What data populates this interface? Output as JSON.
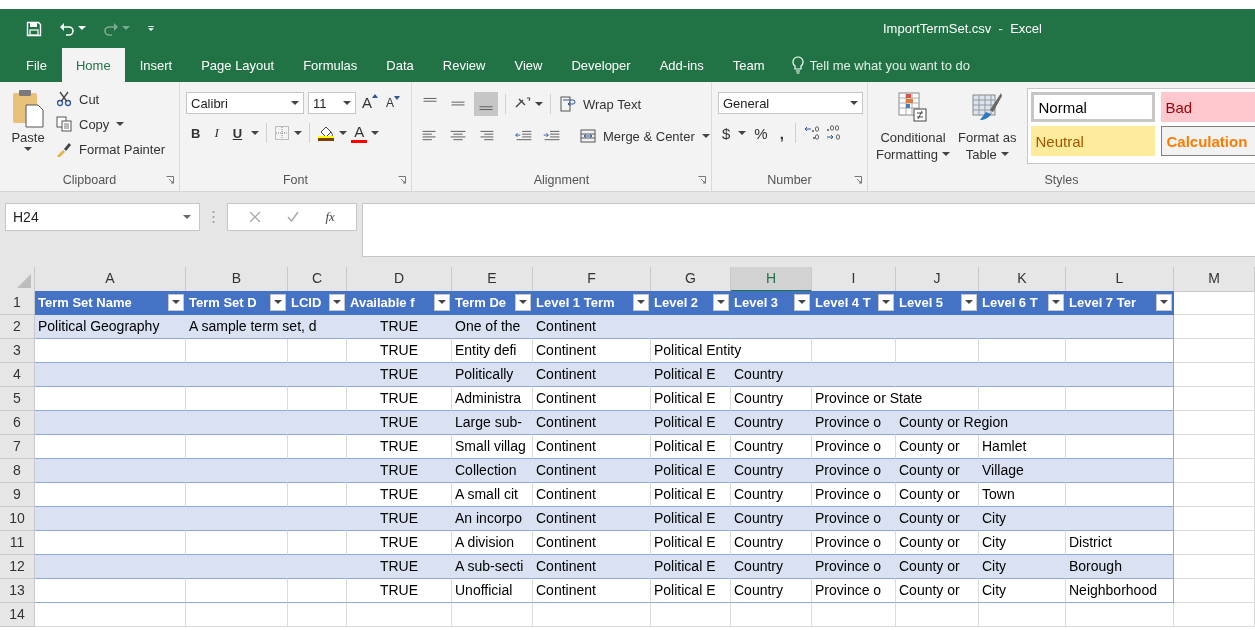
{
  "window": {
    "title": "ImportTermSet.csv  -  Excel"
  },
  "quick_access": {
    "redo_disabled": true
  },
  "tabs": [
    {
      "label": "File",
      "selected": false
    },
    {
      "label": "Home",
      "selected": true
    },
    {
      "label": "Insert",
      "selected": false
    },
    {
      "label": "Page Layout",
      "selected": false
    },
    {
      "label": "Formulas",
      "selected": false
    },
    {
      "label": "Data",
      "selected": false
    },
    {
      "label": "Review",
      "selected": false
    },
    {
      "label": "View",
      "selected": false
    },
    {
      "label": "Developer",
      "selected": false
    },
    {
      "label": "Add-ins",
      "selected": false
    },
    {
      "label": "Team",
      "selected": false
    }
  ],
  "tell_me": {
    "placeholder": "Tell me what you want to do"
  },
  "clipboard": {
    "label": "Clipboard",
    "paste": "Paste",
    "cut": "Cut",
    "copy": "Copy",
    "format_painter": "Format Painter"
  },
  "font": {
    "label": "Font",
    "name": "Calibri",
    "size": "11",
    "grow": "A",
    "shrink": "A",
    "bold": "B",
    "italic": "I",
    "underline": "U",
    "font_color": "A"
  },
  "alignment": {
    "label": "Alignment",
    "vertical": [
      {
        "selected": false
      },
      {
        "selected": false
      },
      {
        "selected": true
      }
    ],
    "wrap_text": "Wrap Text",
    "merge_center": "Merge & Center"
  },
  "number": {
    "label": "Number",
    "format": "General",
    "currency": "$",
    "percent": "%",
    "comma": ","
  },
  "styles": {
    "label": "Styles",
    "conditional_formatting": [
      "Conditional",
      "Formatting"
    ],
    "format_as_table": [
      "Format as",
      "Table"
    ],
    "cell_styles": [
      {
        "label": "Normal",
        "kind": "normal"
      },
      {
        "label": "Bad",
        "kind": "bad"
      },
      {
        "label": "Neutral",
        "kind": "neutral"
      },
      {
        "label": "Calculation",
        "kind": "calculation"
      }
    ]
  },
  "formula_bar": {
    "name_box": "H24",
    "function_label": "fx"
  },
  "sheet": {
    "columns": [
      {
        "label": "A",
        "selected": false
      },
      {
        "label": "B",
        "selected": false
      },
      {
        "label": "C",
        "selected": false
      },
      {
        "label": "D",
        "selected": false
      },
      {
        "label": "E",
        "selected": false
      },
      {
        "label": "F",
        "selected": false
      },
      {
        "label": "G",
        "selected": false
      },
      {
        "label": "H",
        "selected": true
      },
      {
        "label": "I",
        "selected": false
      },
      {
        "label": "J",
        "selected": false
      },
      {
        "label": "K",
        "selected": false
      },
      {
        "label": "L",
        "selected": false
      },
      {
        "label": "M",
        "selected": false
      }
    ],
    "rows": [
      {
        "number": "1",
        "kind": "header",
        "cells": {
          "A": "Term Set Name",
          "B": "Term Set D",
          "C": "LCID",
          "D": "Available f",
          "E": "Term De",
          "F": "Level 1 Term",
          "G": "Level 2",
          "H": "Level 3",
          "I": "Level 4 T",
          "J": "Level 5",
          "K": "Level 6 T",
          "L": "Level 7 Ter"
        }
      },
      {
        "number": "2",
        "kind": "data",
        "cells": {
          "A": "Political Geography",
          "B": "A sample term set, d",
          "D": "TRUE",
          "E": "One of the",
          "F": "Continent"
        }
      },
      {
        "number": "3",
        "kind": "data",
        "cells": {
          "D": "TRUE",
          "E": "Entity defi",
          "F": "Continent",
          "G": "Political Entity"
        }
      },
      {
        "number": "4",
        "kind": "data",
        "cells": {
          "D": "TRUE",
          "E": "Politically",
          "F": "Continent",
          "G": "Political E",
          "H": "Country"
        }
      },
      {
        "number": "5",
        "kind": "data",
        "cells": {
          "D": "TRUE",
          "E": "Administra",
          "F": "Continent",
          "G": "Political E",
          "H": "Country",
          "I": "Province or State"
        }
      },
      {
        "number": "6",
        "kind": "data",
        "cells": {
          "D": "TRUE",
          "E": "Large sub-",
          "F": "Continent",
          "G": "Political E",
          "H": "Country",
          "I": "Province o",
          "J": "County or Region"
        }
      },
      {
        "number": "7",
        "kind": "data",
        "cells": {
          "D": "TRUE",
          "E": "Small villag",
          "F": "Continent",
          "G": "Political E",
          "H": "Country",
          "I": "Province o",
          "J": "County or",
          "K": "Hamlet"
        }
      },
      {
        "number": "8",
        "kind": "data",
        "cells": {
          "D": "TRUE",
          "E": "Collection",
          "F": "Continent",
          "G": "Political E",
          "H": "Country",
          "I": "Province o",
          "J": "County or",
          "K": "Village"
        }
      },
      {
        "number": "9",
        "kind": "data",
        "cells": {
          "D": "TRUE",
          "E": "A small cit",
          "F": "Continent",
          "G": "Political E",
          "H": "Country",
          "I": "Province o",
          "J": "County or",
          "K": "Town"
        }
      },
      {
        "number": "10",
        "kind": "data",
        "cells": {
          "D": "TRUE",
          "E": "An incorpo",
          "F": "Continent",
          "G": "Political E",
          "H": "Country",
          "I": "Province o",
          "J": "County or",
          "K": "City"
        }
      },
      {
        "number": "11",
        "kind": "data",
        "cells": {
          "D": "TRUE",
          "E": "A division",
          "F": "Continent",
          "G": "Political E",
          "H": "Country",
          "I": "Province o",
          "J": "County or",
          "K": "City",
          "L": "District"
        }
      },
      {
        "number": "12",
        "kind": "data",
        "cells": {
          "D": "TRUE",
          "E": "A sub-secti",
          "F": "Continent",
          "G": "Political E",
          "H": "Country",
          "I": "Province o",
          "J": "County or",
          "K": "City",
          "L": "Borough"
        }
      },
      {
        "number": "13",
        "kind": "data",
        "cells": {
          "D": "TRUE",
          "E": "Unofficial",
          "F": "Continent",
          "G": "Political E",
          "H": "Country",
          "I": "Province o",
          "J": "County or",
          "K": "City",
          "L": "Neighborhood"
        }
      },
      {
        "number": "14",
        "kind": "empty"
      }
    ]
  }
}
